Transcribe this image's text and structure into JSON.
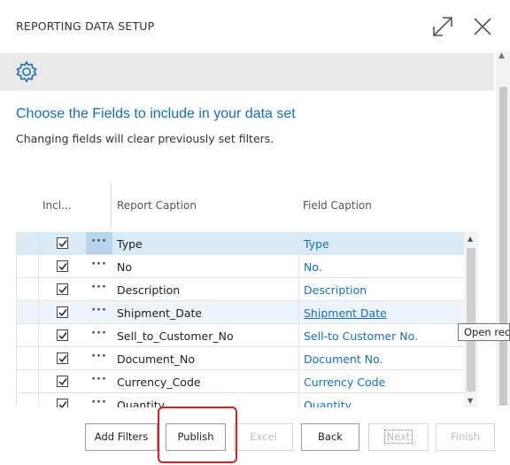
{
  "dialog": {
    "title": "REPORTING DATA SETUP"
  },
  "icons": {
    "expand": "expand-icon",
    "close": "close-icon",
    "settings": "gear-icon"
  },
  "main": {
    "heading": "Choose the Fields to include in your data set",
    "subtext": "Changing fields will clear previously set filters."
  },
  "grid": {
    "headers": {
      "include": "Incl...",
      "report_caption": "Report Caption",
      "field_caption": "Field Caption"
    },
    "rows": [
      {
        "included": true,
        "menu": "···",
        "report_caption": "Type",
        "field_caption": "Type",
        "state": "selected"
      },
      {
        "included": true,
        "menu": "···",
        "report_caption": "No",
        "field_caption": "No.",
        "state": "normal"
      },
      {
        "included": true,
        "menu": "···",
        "report_caption": "Description",
        "field_caption": "Description",
        "state": "normal"
      },
      {
        "included": true,
        "menu": "···",
        "report_caption": "Shipment_Date",
        "field_caption": "Shipment Date",
        "state": "hover"
      },
      {
        "included": true,
        "menu": "···",
        "report_caption": "Sell_to_Customer_No",
        "field_caption": "Sell-to Customer No.",
        "state": "normal"
      },
      {
        "included": true,
        "menu": "···",
        "report_caption": "Document_No",
        "field_caption": "Document No.",
        "state": "normal"
      },
      {
        "included": true,
        "menu": "···",
        "report_caption": "Currency_Code",
        "field_caption": "Currency Code",
        "state": "normal"
      },
      {
        "included": true,
        "menu": "···",
        "report_caption": "Quantity",
        "field_caption": "Quantity",
        "state": "normal"
      }
    ]
  },
  "tooltip": {
    "text": "Open record"
  },
  "footer": {
    "add_filters": "Add Filters",
    "publish": "Publish",
    "excel": "Excel",
    "back": "Back",
    "next": "Next",
    "finish": "Finish"
  },
  "colors": {
    "accent": "#0f6fc6",
    "selected_row": "#dbeaf7",
    "highlight": "#e11e1e"
  }
}
